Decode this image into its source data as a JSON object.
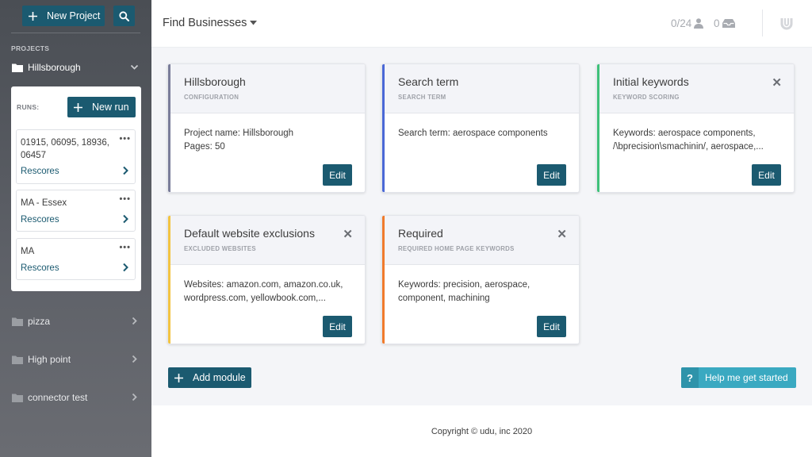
{
  "sidebar": {
    "new_project_label": "New Project",
    "projects_label": "PROJECTS",
    "active_project": "Hillsborough",
    "runs_label": "RUNS:",
    "new_run_label": "New run",
    "runs": [
      {
        "name": "01915, 06095, 18936, 06457",
        "action": "Rescores"
      },
      {
        "name": "MA - Essex",
        "action": "Rescores"
      },
      {
        "name": "MA",
        "action": "Rescores"
      }
    ],
    "projects": [
      {
        "name": "pizza"
      },
      {
        "name": "High point"
      },
      {
        "name": "connector test"
      }
    ]
  },
  "topbar": {
    "title": "Find Businesses",
    "users_count": "0/24",
    "inbox_count": "0"
  },
  "modules": [
    {
      "title": "Hillsborough",
      "subtitle": "CONFIGURATION",
      "lines": [
        "Project name: Hillsborough",
        "Pages: 50"
      ],
      "edit": "Edit",
      "color": "#7a7d9a",
      "closable": false
    },
    {
      "title": "Search term",
      "subtitle": "SEARCH TERM",
      "lines": [
        "Search term: aerospace components"
      ],
      "edit": "Edit",
      "color": "#4a68d6",
      "closable": false
    },
    {
      "title": "Initial keywords",
      "subtitle": "KEYWORD SCORING",
      "lines": [
        "Keywords: aerospace components,",
        "/\\bprecision\\smachinin/, aerospace,..."
      ],
      "edit": "Edit",
      "color": "#3fc17a",
      "closable": true
    },
    {
      "title": "Default website exclusions",
      "subtitle": "EXCLUDED WEBSITES",
      "lines": [
        "Websites: amazon.com, amazon.co.uk,",
        "wordpress.com, yellowbook.com,..."
      ],
      "edit": "Edit",
      "color": "#f3c441",
      "closable": true
    },
    {
      "title": "Required",
      "subtitle": "REQUIRED HOME PAGE KEYWORDS",
      "lines": [
        "Keywords: precision, aerospace,",
        "component, machining"
      ],
      "edit": "Edit",
      "color": "#f07b2c",
      "closable": true
    }
  ],
  "actions": {
    "add_module_label": "Add module",
    "help_label": "Help me get started",
    "help_icon": "?"
  },
  "footer": {
    "copyright": "Copyright © udu, inc 2020"
  },
  "colors": {
    "primary": "#1b5a70",
    "help": "#3aa9c1"
  }
}
